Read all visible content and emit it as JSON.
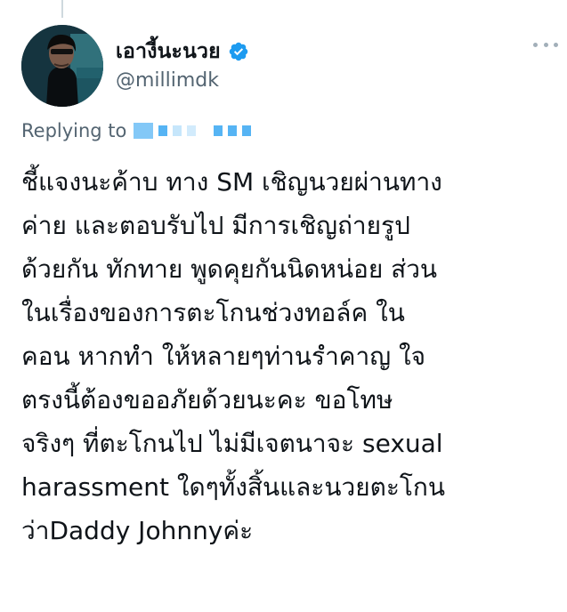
{
  "author": {
    "display_name": "เอางี้นะนวย",
    "handle": "@millimdk",
    "verified": true
  },
  "reply": {
    "prefix": "Replying to"
  },
  "tweet": {
    "lines": [
      "ชี้แจงนะค้าบ ทาง SM เชิญนวยผ่านทาง",
      "ค่าย และตอบรับไป มีการเชิญถ่ายรูป",
      "ด้วยกัน ทักทาย พูดคุยกันนิดหน่อย ส่วน",
      "ในเรื่องของการตะโกนช่วงทอล์ค ใน",
      "คอน หากทำ ให้หลายๆท่านรำคาญ ใจ",
      "ตรงนี้ต้องขออภัยด้วยนะคะ ขอโทษ",
      "จริงๆ ที่ตะโกนไป ไม่มีเจตนาจะ sexual",
      "harassment ใดๆทั้งสิ้นและนวยตะโกน",
      "ว่าDaddy Johnnyค่ะ"
    ]
  },
  "icons": {
    "verified": "verified-badge-icon",
    "more": "more-options-icon"
  },
  "colors": {
    "accent": "#1d9bf0",
    "text_primary": "#0f1419",
    "text_secondary": "#536471"
  }
}
